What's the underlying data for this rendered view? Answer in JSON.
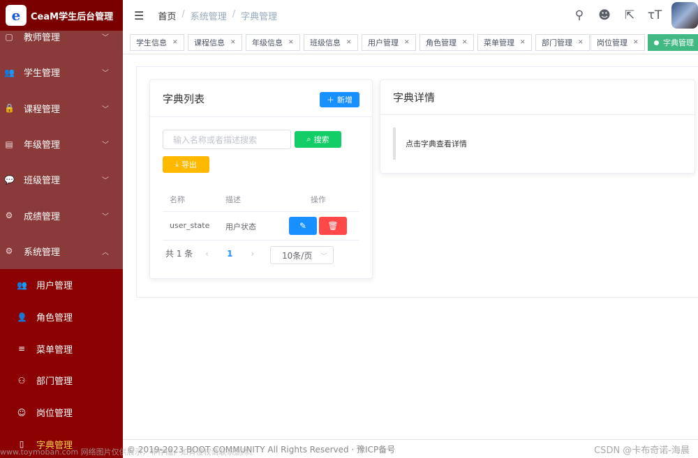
{
  "app": {
    "title": "CeaM学生后台管理",
    "logo_letter": "e"
  },
  "sidebar": {
    "items": [
      {
        "label": "教师管理",
        "icon": "▢"
      },
      {
        "label": "学生管理",
        "icon": "👥"
      },
      {
        "label": "课程管理",
        "icon": "🔒"
      },
      {
        "label": "年级管理",
        "icon": "▤"
      },
      {
        "label": "班级管理",
        "icon": "💬"
      },
      {
        "label": "成绩管理",
        "icon": "⚙"
      },
      {
        "label": "系统管理",
        "icon": "⚙"
      }
    ],
    "sub_items": [
      {
        "label": "用户管理",
        "icon": "👥"
      },
      {
        "label": "角色管理",
        "icon": "👤"
      },
      {
        "label": "菜单管理",
        "icon": "≡"
      },
      {
        "label": "部门管理",
        "icon": "⚇"
      },
      {
        "label": "岗位管理",
        "icon": "☺"
      },
      {
        "label": "字典管理",
        "icon": "▯"
      }
    ]
  },
  "breadcrumb": [
    "首页",
    "系统管理",
    "字典管理"
  ],
  "tags": [
    "学生信息",
    "课程信息",
    "年级信息",
    "班级信息",
    "用户管理",
    "角色管理",
    "菜单管理",
    "部门管理",
    "岗位管理",
    "字典管理"
  ],
  "dict_list": {
    "title": "字典列表",
    "add_label": "新增",
    "search_placeholder": "输入名称或者描述搜索",
    "search_label": "搜索",
    "export_label": "导出",
    "columns": [
      "名称",
      "描述",
      "操作"
    ],
    "rows": [
      {
        "name": "user_state",
        "desc": "用户状态"
      }
    ],
    "total": "共 1 条",
    "page": "1",
    "page_size": "10条/页"
  },
  "dict_detail": {
    "title": "字典详情",
    "hint": "点击字典查看详情"
  },
  "footer": {
    "copyright": "© 2019-2023 BOOT COMMUNITY All Rights Reserved · 豫ICP备号",
    "csdn": "CSDN @卡布奇诺-海晨"
  },
  "watermark": "www.toymoban.com 网络图片仅供展示，非存储，如有侵权请联系删除。",
  "colors": {
    "sidebar": "#8b0000",
    "primary": "#1890ff",
    "success": "#13ce66",
    "warning": "#ffba00",
    "danger": "#ff4949",
    "active_tag": "#42b983"
  }
}
